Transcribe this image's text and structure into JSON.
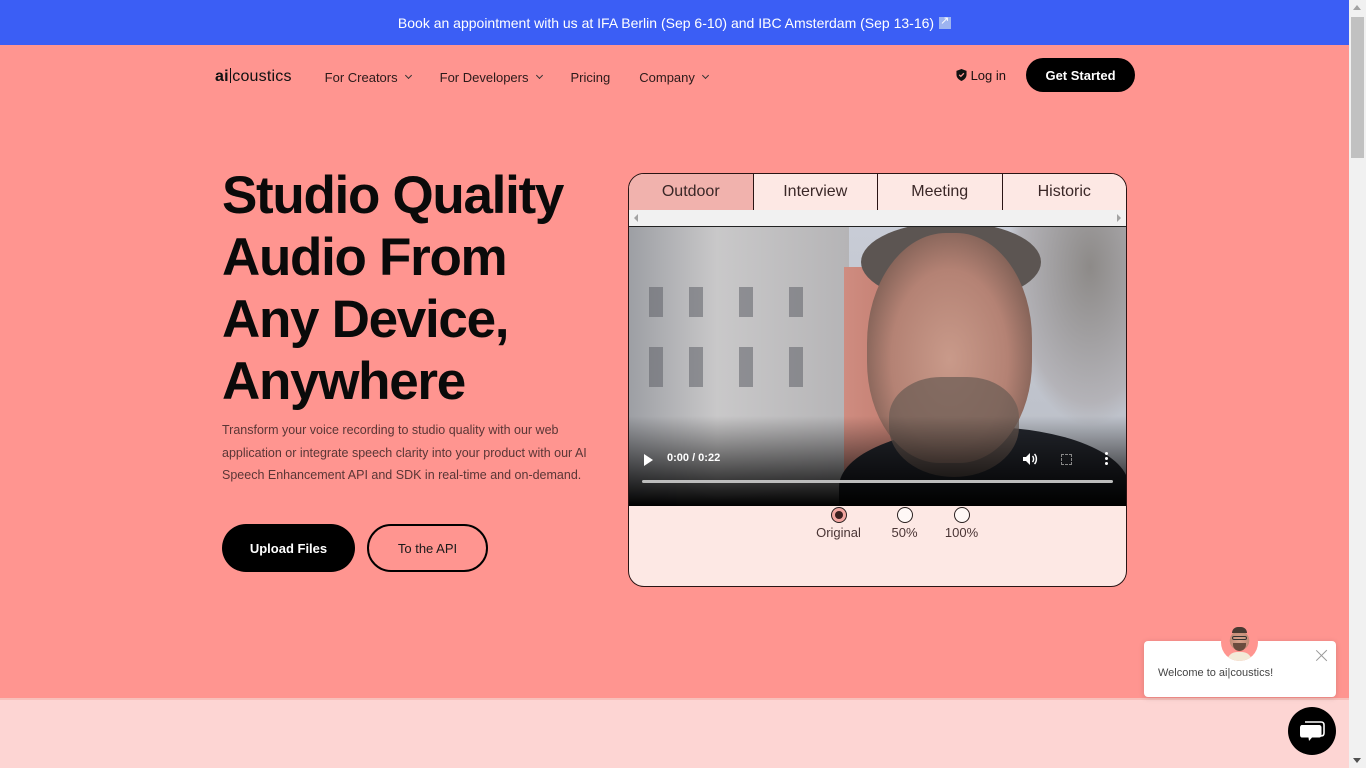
{
  "banner": {
    "text": "Book an appointment with us at IFA Berlin (Sep 6-10) and IBC Amsterdam (Sep 13-16)",
    "icon": "external-link-icon"
  },
  "nav": {
    "logo_bold": "ai",
    "logo_rest": "coustics",
    "items": [
      {
        "label": "For Creators",
        "has_dropdown": true
      },
      {
        "label": "For Developers",
        "has_dropdown": true
      },
      {
        "label": "Pricing",
        "has_dropdown": false
      },
      {
        "label": "Company",
        "has_dropdown": true
      }
    ],
    "login_label": "Log in",
    "cta_label": "Get Started"
  },
  "hero": {
    "headline_lines": [
      "Studio Quality",
      "Audio From",
      "Any Device,",
      "Anywhere"
    ],
    "subtext": "Transform your voice recording to studio quality with our web application or integrate speech clarity into your product with our AI Speech Enhancement API and SDK in real-time and on-demand.",
    "primary_button": "Upload Files",
    "secondary_button": "To the API"
  },
  "demo": {
    "tabs": [
      {
        "label": "Outdoor",
        "active": true
      },
      {
        "label": "Interview",
        "active": false
      },
      {
        "label": "Meeting",
        "active": false
      },
      {
        "label": "Historic",
        "active": false
      }
    ],
    "video": {
      "time": "0:00 / 0:22",
      "progress": 0
    },
    "enhancement_options": [
      {
        "label": "Original",
        "selected": true
      },
      {
        "label": "50%",
        "selected": false
      },
      {
        "label": "100%",
        "selected": false
      }
    ]
  },
  "chat": {
    "welcome_message": "Welcome to ai|coustics!"
  },
  "colors": {
    "banner": "#3b5ef5",
    "hero_bg": "#ff9590",
    "lower_bg": "#fdd5d3",
    "active_tab": "#f1b2ad",
    "demo_bg": "#fde8e4",
    "button_dark": "#000000"
  }
}
